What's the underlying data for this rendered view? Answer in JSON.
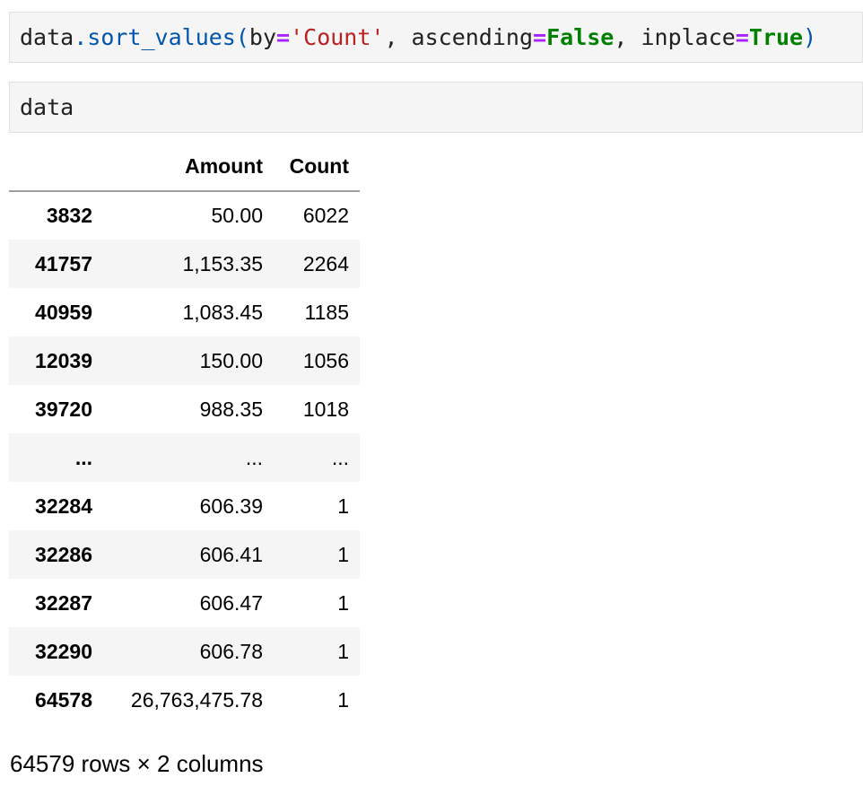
{
  "cells": [
    {
      "tokens": [
        {
          "text": "data",
          "kind": "name"
        },
        {
          "text": ".",
          "kind": "punc"
        },
        {
          "text": "sort_values",
          "kind": "attr"
        },
        {
          "text": "(",
          "kind": "punc"
        },
        {
          "text": "by",
          "kind": "name"
        },
        {
          "text": "=",
          "kind": "op"
        },
        {
          "text": "'Count'",
          "kind": "str"
        },
        {
          "text": ", ascending",
          "kind": "name"
        },
        {
          "text": "=",
          "kind": "op"
        },
        {
          "text": "False",
          "kind": "kw"
        },
        {
          "text": ", inplace",
          "kind": "name"
        },
        {
          "text": "=",
          "kind": "op"
        },
        {
          "text": "True",
          "kind": "kw"
        },
        {
          "text": ")",
          "kind": "punc"
        }
      ]
    },
    {
      "tokens": [
        {
          "text": "data",
          "kind": "name"
        }
      ]
    }
  ],
  "table": {
    "index_header": "",
    "columns": [
      "Amount",
      "Count"
    ],
    "rows": [
      {
        "index": "3832",
        "amount": "50.00",
        "count": "6022"
      },
      {
        "index": "41757",
        "amount": "1,153.35",
        "count": "2264"
      },
      {
        "index": "40959",
        "amount": "1,083.45",
        "count": "1185"
      },
      {
        "index": "12039",
        "amount": "150.00",
        "count": "1056"
      },
      {
        "index": "39720",
        "amount": "988.35",
        "count": "1018"
      },
      {
        "index": "...",
        "amount": "...",
        "count": "..."
      },
      {
        "index": "32284",
        "amount": "606.39",
        "count": "1"
      },
      {
        "index": "32286",
        "amount": "606.41",
        "count": "1"
      },
      {
        "index": "32287",
        "amount": "606.47",
        "count": "1"
      },
      {
        "index": "32290",
        "amount": "606.78",
        "count": "1"
      },
      {
        "index": "64578",
        "amount": "26,763,475.78",
        "count": "1"
      }
    ]
  },
  "shape_text": "64579 rows × 2 columns"
}
